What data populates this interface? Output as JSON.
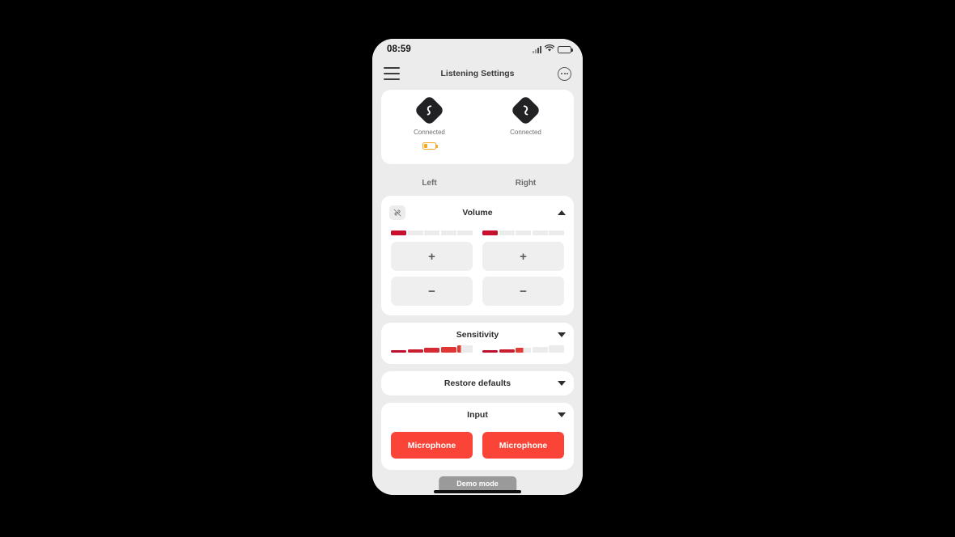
{
  "status_bar": {
    "time": "08:59",
    "signal_icon": "cellular-signal-icon",
    "wifi_icon": "wifi-icon",
    "battery_icon": "battery-icon"
  },
  "app_bar": {
    "menu_icon": "hamburger-menu-icon",
    "title": "Listening Settings",
    "more_icon": "more-options-icon"
  },
  "devices": {
    "left": {
      "icon": "hearing-aid-icon",
      "status": "Connected",
      "battery_icon": "battery-low-icon",
      "battery_color": "#f5a623",
      "battery_level_pct": 28
    },
    "right": {
      "icon": "hearing-aid-icon",
      "status": "Connected"
    }
  },
  "side_labels": {
    "left": "Left",
    "right": "Right"
  },
  "accent_colors": {
    "level_fill": "#c8102e",
    "level_track": "#ebebeb",
    "mic_button": "#f94437",
    "battery_warning": "#f5a623"
  },
  "volume": {
    "title": "Volume",
    "link_icon": "unlink-icon",
    "caret_icon": "chevron-up-icon",
    "expanded": true,
    "segments": 5,
    "left_level": 1,
    "right_level": 1,
    "increase_label": "+",
    "decrease_label": "−"
  },
  "sensitivity": {
    "title": "Sensitivity",
    "caret_icon": "chevron-down-icon",
    "expanded": false,
    "segments": 5,
    "left_level": 4,
    "right_level": 2,
    "left_partial": 0.25,
    "right_partial": 0.5
  },
  "restore_defaults": {
    "title": "Restore defaults",
    "caret_icon": "chevron-down-icon",
    "expanded": false
  },
  "input": {
    "title": "Input",
    "caret_icon": "chevron-down-icon",
    "expanded": false,
    "left_source": "Microphone",
    "right_source": "Microphone"
  },
  "toast": {
    "text": "Demo mode"
  }
}
